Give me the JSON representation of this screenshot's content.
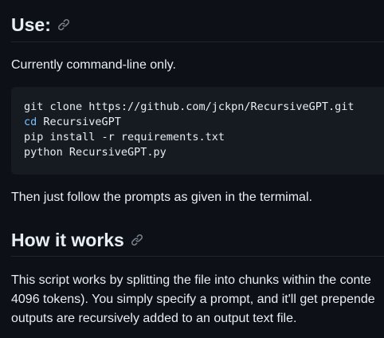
{
  "sections": {
    "use": {
      "heading": "Use:",
      "intro": "Currently command-line only.",
      "code": {
        "line1": "git clone https://github.com/jckpn/RecursiveGPT.git",
        "line2_cmd": "cd",
        "line2_arg": " RecursiveGPT",
        "line3": "pip install -r requirements.txt",
        "line4": "python RecursiveGPT.py"
      },
      "follow": "Then just follow the prompts as given in the termimal."
    },
    "how": {
      "heading": "How it works",
      "lines": [
        "This script works by splitting the file into chunks within the conte",
        "4096 tokens). You simply specify a prompt, and it'll get prepende",
        "outputs are recursively added to an output text file."
      ]
    }
  },
  "icons": {
    "anchor_link": "link-icon"
  },
  "colors": {
    "background": "#0d1117",
    "code_background": "#161b22",
    "text": "#e6edf3",
    "keyword": "#79c0ff",
    "icon": "#7d8590"
  }
}
